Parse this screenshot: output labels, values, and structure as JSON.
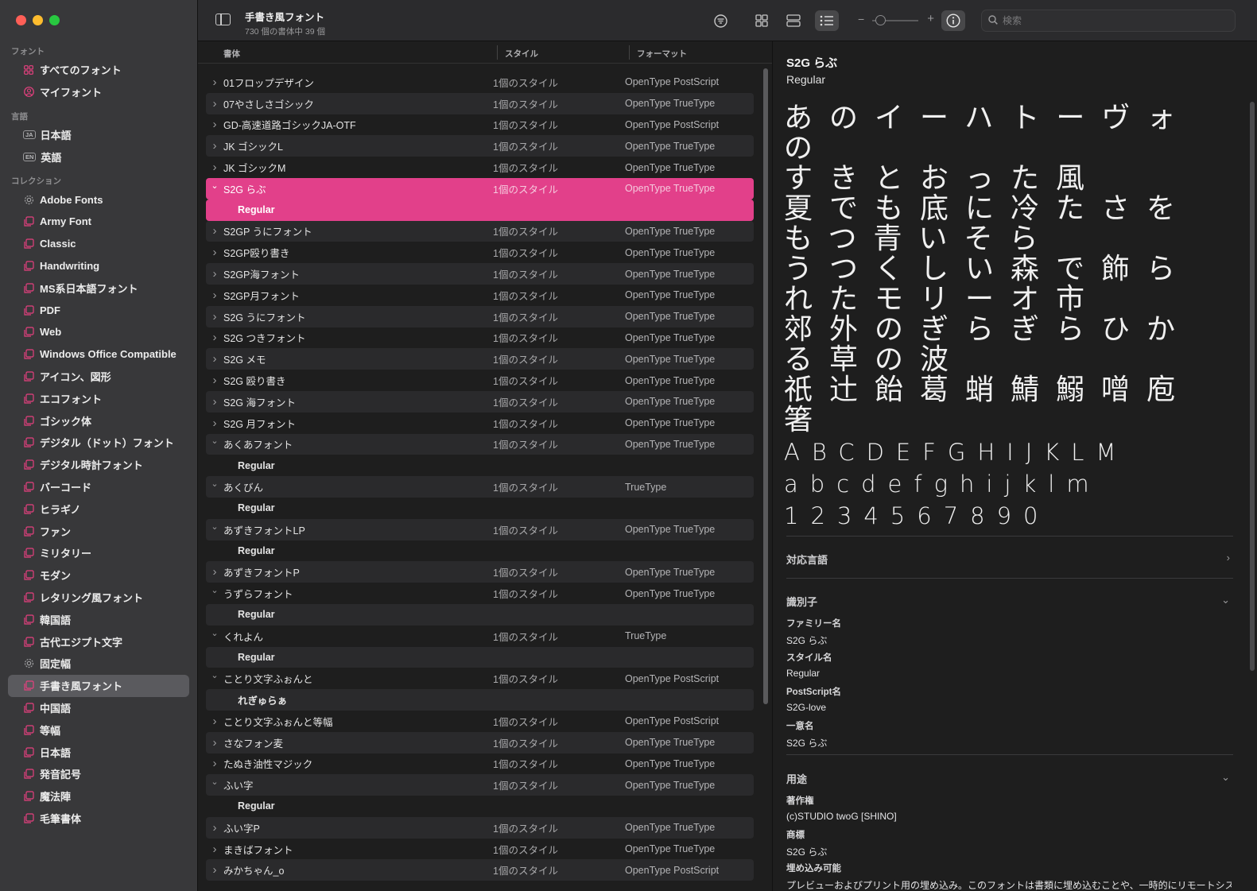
{
  "sidebar": {
    "sections": [
      {
        "heading": "フォント",
        "items": [
          {
            "label": "すべてのフォント",
            "icon": "grid-icon"
          },
          {
            "label": "マイフォント",
            "icon": "person-icon"
          }
        ]
      },
      {
        "heading": "言語",
        "items": [
          {
            "label": "日本語",
            "badge": "JA"
          },
          {
            "label": "英語",
            "badge": "EN"
          }
        ]
      },
      {
        "heading": "コレクション",
        "items": [
          {
            "label": "Adobe Fonts",
            "icon": "gear-icon"
          },
          {
            "label": "Army Font",
            "icon": "collection-icon"
          },
          {
            "label": "Classic",
            "icon": "collection-icon"
          },
          {
            "label": "Handwriting",
            "icon": "collection-icon"
          },
          {
            "label": "MS系日本語フォント",
            "icon": "collection-icon"
          },
          {
            "label": "PDF",
            "icon": "collection-icon"
          },
          {
            "label": "Web",
            "icon": "collection-icon"
          },
          {
            "label": "Windows Office Compatible",
            "icon": "collection-icon"
          },
          {
            "label": "アイコン、図形",
            "icon": "collection-icon"
          },
          {
            "label": "エコフォント",
            "icon": "collection-icon"
          },
          {
            "label": "ゴシック体",
            "icon": "collection-icon"
          },
          {
            "label": "デジタル（ドット）フォント",
            "icon": "collection-icon"
          },
          {
            "label": "デジタル時計フォント",
            "icon": "collection-icon"
          },
          {
            "label": "バーコード",
            "icon": "collection-icon"
          },
          {
            "label": "ヒラギノ",
            "icon": "collection-icon"
          },
          {
            "label": "ファン",
            "icon": "collection-icon"
          },
          {
            "label": "ミリタリー",
            "icon": "collection-icon"
          },
          {
            "label": "モダン",
            "icon": "collection-icon"
          },
          {
            "label": "レタリング風フォント",
            "icon": "collection-icon"
          },
          {
            "label": "韓国語",
            "icon": "collection-icon"
          },
          {
            "label": "古代エジプト文字",
            "icon": "collection-icon"
          },
          {
            "label": "固定幅",
            "icon": "gear-icon"
          },
          {
            "label": "手書き風フォント",
            "icon": "collection-icon",
            "selected": true
          },
          {
            "label": "中国語",
            "icon": "collection-icon"
          },
          {
            "label": "等幅",
            "icon": "collection-icon"
          },
          {
            "label": "日本語",
            "icon": "collection-icon"
          },
          {
            "label": "発音記号",
            "icon": "collection-icon"
          },
          {
            "label": "魔法陣",
            "icon": "collection-icon"
          },
          {
            "label": "毛筆書体",
            "icon": "collection-icon"
          }
        ]
      }
    ]
  },
  "toolbar": {
    "title": "手書き風フォント",
    "subtitle": "730 個の書体中 39 個",
    "search_placeholder": "検索"
  },
  "columns": {
    "name": "書体",
    "style": "スタイル",
    "format": "フォーマット"
  },
  "rows": [
    {
      "name": "01フロップデザイン",
      "style": "1個のスタイル",
      "format": "OpenType PostScript",
      "expanded": false
    },
    {
      "name": "07やさしさゴシック",
      "style": "1個のスタイル",
      "format": "OpenType TrueType",
      "expanded": false
    },
    {
      "name": "GD-高速道路ゴシックJA-OTF",
      "style": "1個のスタイル",
      "format": "OpenType PostScript",
      "expanded": false
    },
    {
      "name": "JK ゴシックL",
      "style": "1個のスタイル",
      "format": "OpenType TrueType",
      "expanded": false
    },
    {
      "name": "JK ゴシックM",
      "style": "1個のスタイル",
      "format": "OpenType TrueType",
      "expanded": false
    },
    {
      "name": "S2G らぶ",
      "style": "1個のスタイル",
      "format": "OpenType TrueType",
      "expanded": true,
      "selected": true
    },
    {
      "name": "Regular",
      "child": true,
      "selected": true
    },
    {
      "name": "S2GP うにフォント",
      "style": "1個のスタイル",
      "format": "OpenType TrueType",
      "expanded": false
    },
    {
      "name": "S2GP殴り書き",
      "style": "1個のスタイル",
      "format": "OpenType TrueType",
      "expanded": false
    },
    {
      "name": "S2GP海フォント",
      "style": "1個のスタイル",
      "format": "OpenType TrueType",
      "expanded": false
    },
    {
      "name": "S2GP月フォント",
      "style": "1個のスタイル",
      "format": "OpenType TrueType",
      "expanded": false
    },
    {
      "name": "S2G うにフォント",
      "style": "1個のスタイル",
      "format": "OpenType TrueType",
      "expanded": false
    },
    {
      "name": "S2G つきフォント",
      "style": "1個のスタイル",
      "format": "OpenType TrueType",
      "expanded": false
    },
    {
      "name": "S2G メモ",
      "style": "1個のスタイル",
      "format": "OpenType TrueType",
      "expanded": false
    },
    {
      "name": "S2G 殴り書き",
      "style": "1個のスタイル",
      "format": "OpenType TrueType",
      "expanded": false
    },
    {
      "name": "S2G 海フォント",
      "style": "1個のスタイル",
      "format": "OpenType TrueType",
      "expanded": false
    },
    {
      "name": "S2G 月フォント",
      "style": "1個のスタイル",
      "format": "OpenType TrueType",
      "expanded": false
    },
    {
      "name": "あくあフォント",
      "style": "1個のスタイル",
      "format": "OpenType TrueType",
      "expanded": true
    },
    {
      "name": "Regular",
      "child": true
    },
    {
      "name": "あくびん",
      "style": "1個のスタイル",
      "format": "TrueType",
      "expanded": true
    },
    {
      "name": "Regular",
      "child": true
    },
    {
      "name": "あずきフォントLP",
      "style": "1個のスタイル",
      "format": "OpenType TrueType",
      "expanded": true
    },
    {
      "name": "Regular",
      "child": true
    },
    {
      "name": "あずきフォントP",
      "style": "1個のスタイル",
      "format": "OpenType TrueType",
      "expanded": false
    },
    {
      "name": "うずらフォント",
      "style": "1個のスタイル",
      "format": "OpenType TrueType",
      "expanded": true
    },
    {
      "name": "Regular",
      "child": true
    },
    {
      "name": "くれよん",
      "style": "1個のスタイル",
      "format": "TrueType",
      "expanded": true
    },
    {
      "name": "Regular",
      "child": true
    },
    {
      "name": "ことり文字ふぉんと",
      "style": "1個のスタイル",
      "format": "OpenType PostScript",
      "expanded": true
    },
    {
      "name": "れぎゅらぁ",
      "child": true
    },
    {
      "name": "ことり文字ふぉんと等幅",
      "style": "1個のスタイル",
      "format": "OpenType PostScript",
      "expanded": false
    },
    {
      "name": "さなフォン麦",
      "style": "1個のスタイル",
      "format": "OpenType TrueType",
      "expanded": false
    },
    {
      "name": "たぬき油性マジック",
      "style": "1個のスタイル",
      "format": "OpenType TrueType",
      "expanded": false
    },
    {
      "name": "ふい字",
      "style": "1個のスタイル",
      "format": "OpenType TrueType",
      "expanded": true
    },
    {
      "name": "Regular",
      "child": true
    },
    {
      "name": "ふい字P",
      "style": "1個のスタイル",
      "format": "OpenType TrueType",
      "expanded": false
    },
    {
      "name": "まきばフォント",
      "style": "1個のスタイル",
      "format": "OpenType TrueType",
      "expanded": false
    },
    {
      "name": "みかちゃん_o",
      "style": "1個のスタイル",
      "format": "OpenType PostScript",
      "expanded": false
    }
  ],
  "preview": {
    "family_title": "S2G らぶ",
    "style_title": "Regular",
    "sample_lines": [
      "あのイーハトーヴォの",
      "すきとおった風",
      "夏でも底に冷たさを",
      "もつ青いそら",
      "うつくしい森で飾ら",
      "れたモリーオ市",
      "郊外のぎらぎらひか",
      "る草の波",
      "祇辻飴葛蛸鯖鰯噌庖",
      "箸"
    ],
    "latin_upper": "ABCDEFGHIJKLM",
    "latin_lower": "abcdefghijklm",
    "digits": "1234567890",
    "section_languages": "対応言語",
    "section_identifier": "識別子",
    "family_name_label": "ファミリー名",
    "family_name_value": "S2G らぶ",
    "style_name_label": "スタイル名",
    "style_name_value": "Regular",
    "postscript_label": "PostScript名",
    "postscript_value": "S2G-love",
    "unique_label": "一意名",
    "unique_value": "S2G らぶ",
    "section_usage": "用途",
    "copyright_label": "著作権",
    "copyright_value": "(c)STUDIO twoG [SHINO]",
    "trademark_label": "商標",
    "trademark_value": "S2G らぶ",
    "embed_label": "埋め込み可能",
    "embed_value": "プレビューおよびプリント用の埋め込み。このフォントは書類に埋め込むことや、一時的にリモートシステム"
  },
  "colors": {
    "accent": "#e2408a",
    "sidebar_bg": "#38383a",
    "content_bg": "#1e1e1e"
  }
}
